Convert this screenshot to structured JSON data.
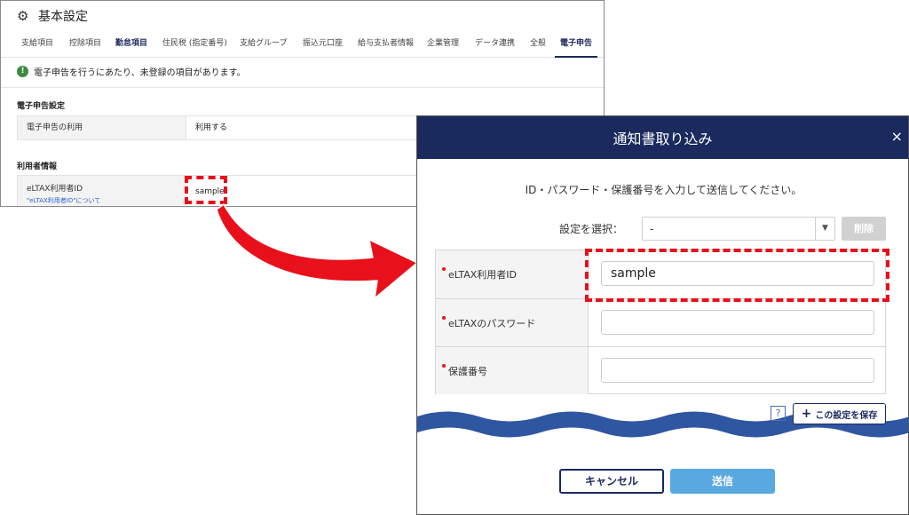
{
  "background_page": {
    "title": "基本設定",
    "gear_icon": "⚙",
    "tabs": [
      {
        "label": "支給項目",
        "state": "normal"
      },
      {
        "label": "控除項目",
        "state": "normal"
      },
      {
        "label": "勤怠項目",
        "state": "bold"
      },
      {
        "label": "住民税 (指定番号)",
        "state": "normal"
      },
      {
        "label": "支給グループ",
        "state": "normal"
      },
      {
        "label": "振込元口座",
        "state": "normal"
      },
      {
        "label": "給与支払者情報",
        "state": "normal"
      },
      {
        "label": "企業管理",
        "state": "normal"
      },
      {
        "label": "データ連携",
        "state": "normal"
      },
      {
        "label": "全般",
        "state": "normal"
      },
      {
        "label": "電子申告",
        "state": "active"
      }
    ],
    "notice": {
      "icon": "!",
      "text": "電子申告を行うにあたり、未登録の項目があります。"
    },
    "section1": {
      "title": "電子申告設定",
      "row_label": "電子申告の利用",
      "row_value": "利用する"
    },
    "section2": {
      "title": "利用者情報",
      "row_label": "eLTAX利用者ID",
      "row_link": "\"eLTAX利用者ID\"について",
      "row_value": "sample"
    }
  },
  "dialog": {
    "title": "通知書取り込み",
    "close_icon": "×",
    "instruction": "ID・パスワード・保護番号を入力して送信してください。",
    "select_label": "設定を選択：",
    "select_value": "-",
    "select_arrow": "▼",
    "delete_button": "削除",
    "fields": [
      {
        "label": "eLTAX利用者ID",
        "value": "sample"
      },
      {
        "label": "eLTAXのパスワード",
        "value": ""
      },
      {
        "label": "保護番号",
        "value": ""
      }
    ],
    "help_icon": "?",
    "save_button": {
      "icon": "+",
      "label": "この設定を保存"
    },
    "cancel_button": "キャンセル",
    "send_button": "送信"
  },
  "colors": {
    "accent_navy": "#1a2a5e",
    "highlight_red": "#e8101a",
    "wave_blue": "#2f56a0",
    "send_blue": "#5aa8e0"
  }
}
